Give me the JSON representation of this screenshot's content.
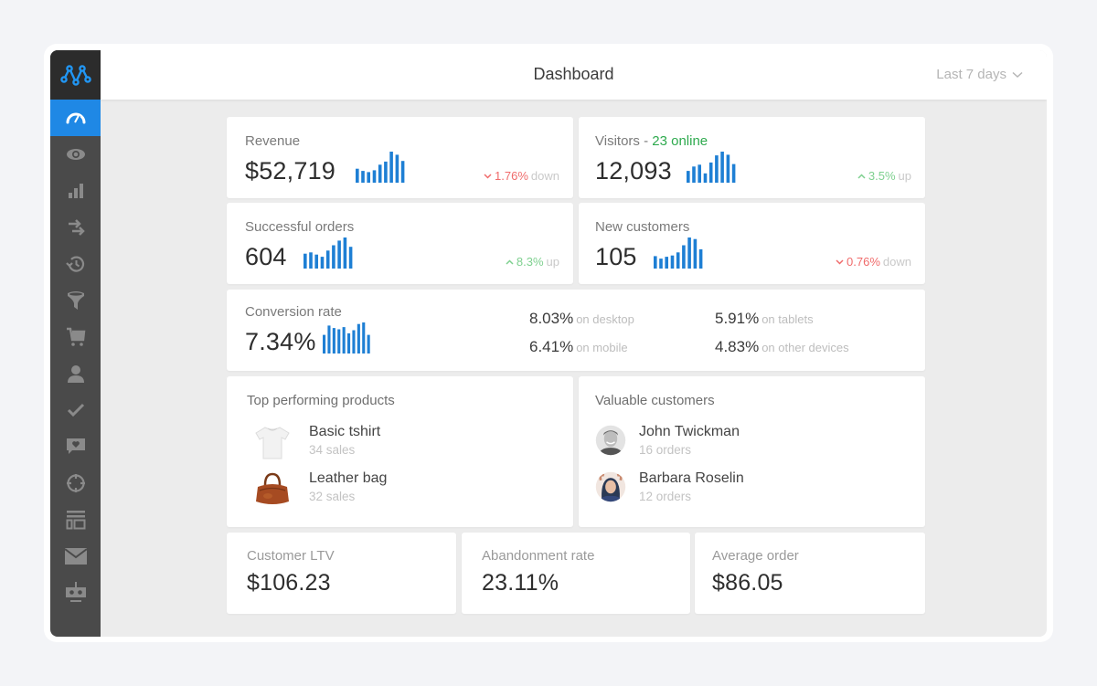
{
  "header": {
    "title": "Dashboard",
    "range_label": "Last 7 days"
  },
  "sidebar": {
    "logo": "logo-icon",
    "items": [
      {
        "icon": "speedometer-icon",
        "active": true
      },
      {
        "icon": "eye-icon",
        "active": false
      },
      {
        "icon": "bar-chart-icon",
        "active": false
      },
      {
        "icon": "transfer-arrows-icon",
        "active": false
      },
      {
        "icon": "history-icon",
        "active": false
      },
      {
        "icon": "funnel-icon",
        "active": false
      },
      {
        "icon": "cart-icon",
        "active": false
      },
      {
        "icon": "user-icon",
        "active": false
      },
      {
        "icon": "checkmark-icon",
        "active": false
      },
      {
        "icon": "heart-message-icon",
        "active": false
      },
      {
        "icon": "target-icon",
        "active": false
      },
      {
        "icon": "layout-icon",
        "active": false
      },
      {
        "icon": "mail-icon",
        "active": false
      },
      {
        "icon": "robot-icon",
        "active": false
      }
    ]
  },
  "colors": {
    "accent": "#1f88e5",
    "sparkline": "#1e7fd4",
    "up": "#7ed08f",
    "down": "#f06b6b",
    "online": "#2eaa4e"
  },
  "metrics": {
    "revenue": {
      "label": "Revenue",
      "value": "$52,719",
      "trend_pct": "1.76%",
      "trend_word": "down",
      "direction": "down",
      "bars": [
        0.45,
        0.38,
        0.34,
        0.4,
        0.58,
        0.68,
        1.0,
        0.9,
        0.7
      ]
    },
    "visitors": {
      "label": "Visitors",
      "separator": " - ",
      "online": "23 online",
      "value": "12,093",
      "trend_pct": "3.5%",
      "trend_word": "up",
      "direction": "up",
      "bars": [
        0.38,
        0.52,
        0.58,
        0.3,
        0.65,
        0.88,
        1.0,
        0.9,
        0.6
      ]
    },
    "orders": {
      "label": "Successful orders",
      "value": "604",
      "trend_pct": "8.3%",
      "trend_word": "up",
      "direction": "up",
      "bars": [
        0.48,
        0.52,
        0.45,
        0.38,
        0.58,
        0.75,
        0.9,
        1.0,
        0.7
      ]
    },
    "new_customers": {
      "label": "New customers",
      "value": "105",
      "trend_pct": "0.76%",
      "trend_word": "down",
      "direction": "down",
      "bars": [
        0.4,
        0.32,
        0.38,
        0.42,
        0.52,
        0.75,
        1.0,
        0.95,
        0.62
      ]
    },
    "conversion": {
      "label": "Conversion rate",
      "value": "7.34%",
      "bars": [
        0.6,
        0.9,
        0.82,
        0.78,
        0.85,
        0.65,
        0.75,
        0.95,
        1.0,
        0.6
      ],
      "breakdown": [
        {
          "value": "8.03%",
          "label": "on desktop"
        },
        {
          "value": "5.91%",
          "label": "on tablets"
        },
        {
          "value": "6.41%",
          "label": "on mobile"
        },
        {
          "value": "4.83%",
          "label": "on other devices"
        }
      ]
    }
  },
  "top_products": {
    "title": "Top performing products",
    "items": [
      {
        "name": "Basic tshirt",
        "sub": "34 sales",
        "image": "tshirt-image"
      },
      {
        "name": "Leather bag",
        "sub": "32 sales",
        "image": "leather-bag-image"
      }
    ]
  },
  "valuable_customers": {
    "title": "Valuable customers",
    "items": [
      {
        "name": "John Twickman",
        "sub": "16 orders",
        "avatar": "avatar-john"
      },
      {
        "name": "Barbara Roselin",
        "sub": "12 orders",
        "avatar": "avatar-barbara"
      }
    ]
  },
  "summary": [
    {
      "label": "Customer LTV",
      "value": "$106.23"
    },
    {
      "label": "Abandonment rate",
      "value": "23.11%"
    },
    {
      "label": "Average order",
      "value": "$86.05"
    }
  ]
}
